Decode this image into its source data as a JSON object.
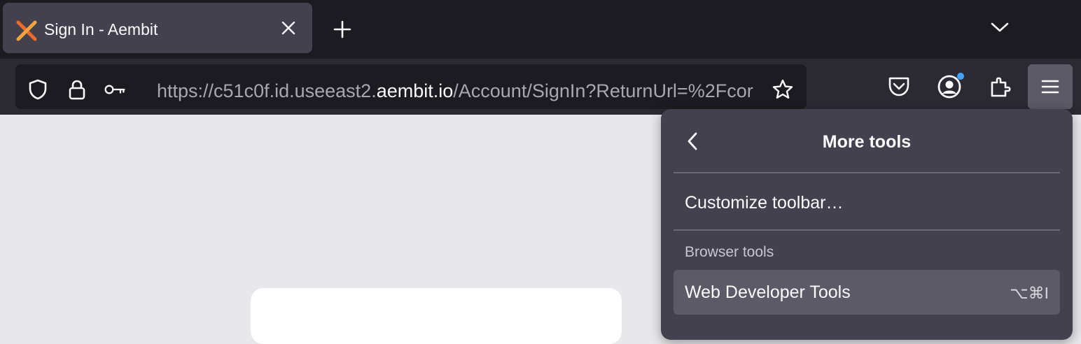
{
  "tab": {
    "title": "Sign In - Aembit",
    "favicon": "aembit-logo-icon",
    "close_icon": "close-icon"
  },
  "newtab_icon": "plus-icon",
  "tablist_icon": "chevron-down-icon",
  "urlbar": {
    "url_prefix": "https://c51c0f.id.useeast2.",
    "url_host": "aembit.io",
    "url_suffix": "/Account/SignIn?ReturnUrl=%2Fcor",
    "icons": [
      "shield-icon",
      "lock-icon",
      "key-icon",
      "star-icon"
    ]
  },
  "toolbar": {
    "icons": [
      "pocket-icon",
      "account-icon",
      "extensions-icon",
      "hamburger-menu-icon"
    ]
  },
  "panel": {
    "title": "More tools",
    "back_icon": "chevron-left-icon",
    "customize": "Customize toolbar…",
    "section": "Browser tools",
    "web_dev": "Web Developer Tools",
    "web_dev_shortcut": "⌥⌘I"
  },
  "colors": {
    "tabbar_bg": "#1c1b22",
    "navbar_bg": "#2b2a33",
    "panel_bg": "#42414d",
    "highlight": "#5b5a66",
    "page_bg": "#e8e7ec",
    "notification_dot": "#3fa3ff"
  }
}
